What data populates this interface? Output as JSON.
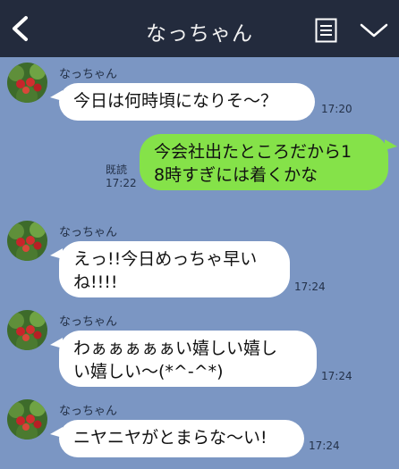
{
  "header": {
    "title": "なっちゃん"
  },
  "icons": {
    "back": "chevron-left-icon",
    "menu": "note-list-icon",
    "toggle": "chevron-down-icon"
  },
  "messages": [
    {
      "sender": "なっちゃん",
      "text": "今日は何時頃になりそ〜？",
      "time": "17:20"
    },
    {
      "read_label": "既読",
      "text_line1": "今会社出たところだから1",
      "text_line2": "8時すぎには着くかな",
      "time": "17:22"
    },
    {
      "sender": "なっちゃん",
      "text_line1": "えっ!!今日めっちゃ早い",
      "text_line2": "ね!!!!",
      "time": "17:24"
    },
    {
      "sender": "なっちゃん",
      "text_line1": "わぁぁぁぁぁい嬉しい嬉し",
      "text_line2": "い嬉しい〜(*^-^*)",
      "time": "17:24"
    },
    {
      "sender": "なっちゃん",
      "text": "ニヤニヤがとまらな〜い!",
      "time": "17:24"
    }
  ],
  "colors": {
    "background": "#7b96c3",
    "header": "#232b3d",
    "incoming_bubble": "#ffffff",
    "outgoing_bubble": "#85e249"
  }
}
